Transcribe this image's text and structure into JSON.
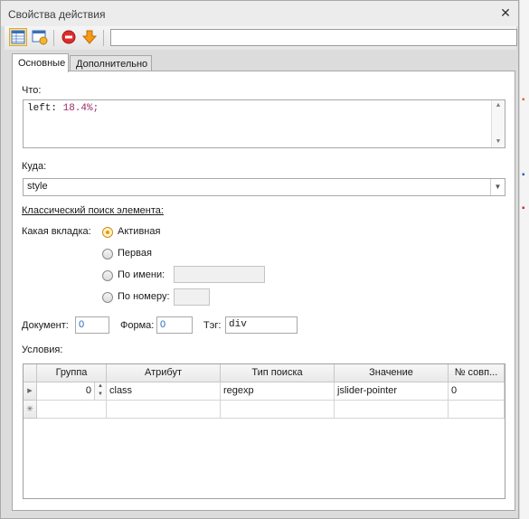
{
  "window": {
    "title": "Свойства действия",
    "close_glyph": "✕"
  },
  "toolbar": {
    "input_value": ""
  },
  "tabs": [
    {
      "label": "Основные",
      "active": true
    },
    {
      "label": "Дополнительно",
      "active": false
    }
  ],
  "what": {
    "label": "Что:",
    "code_prop": "left: ",
    "code_value": "18.4%;"
  },
  "where": {
    "label": "Куда:",
    "value": "style"
  },
  "classic": {
    "heading": "Классический поиск элемента:",
    "tab_label": "Какая вкладка:",
    "options": {
      "active": "Активная",
      "first": "Первая",
      "by_name": "По имени:",
      "by_number": "По номеру:"
    },
    "selected": "active"
  },
  "refs": {
    "document_label": "Документ:",
    "document_value": "0",
    "form_label": "Форма:",
    "form_value": "0",
    "tag_label": "Тэг:",
    "tag_value": "div"
  },
  "conditions": {
    "label": "Условия:",
    "columns": [
      "Группа",
      "Атрибут",
      "Тип поиска",
      "Значение",
      "№ совп..."
    ],
    "rows": [
      {
        "group": "0",
        "attribute": "class",
        "search_type": "regexp",
        "value": "jslider-pointer",
        "match_no": "0"
      }
    ],
    "new_row_marker": "✳"
  },
  "colors": {
    "accent_orange": "#e09a1a",
    "stop_red": "#e02b2b",
    "number_blue": "#1f6aba"
  }
}
